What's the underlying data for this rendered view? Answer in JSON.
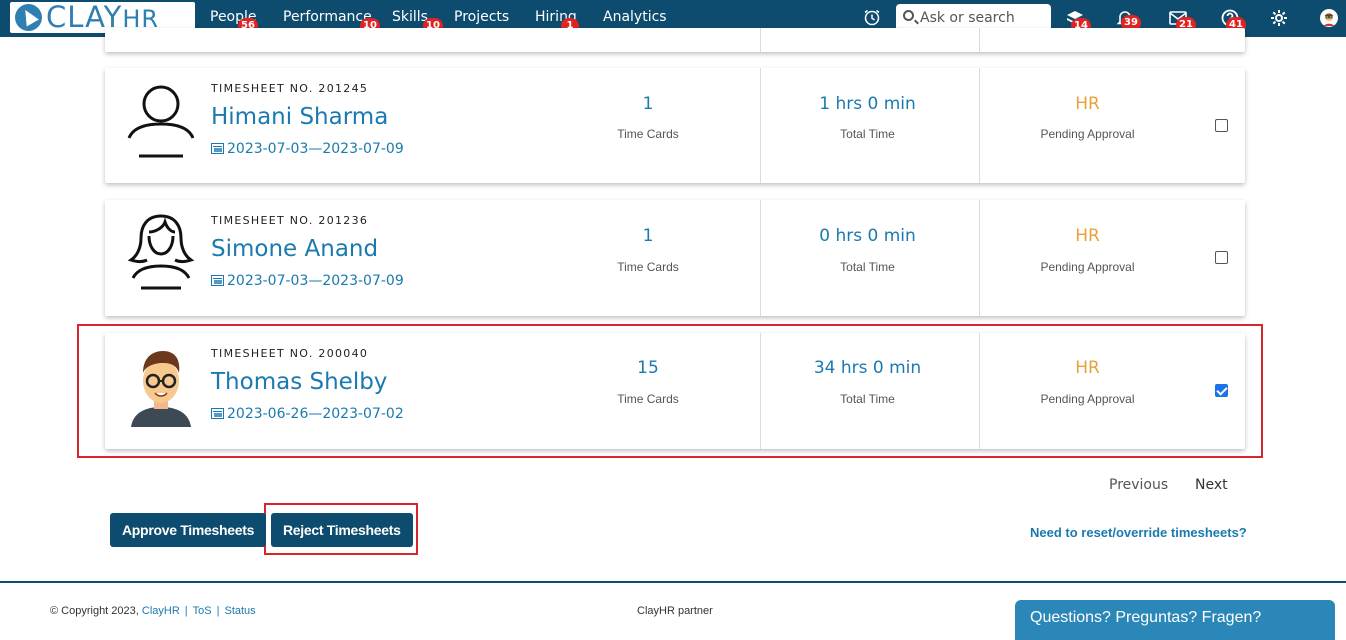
{
  "app": {
    "logo_text": "CLAY",
    "logo_suffix": "HR"
  },
  "nav": {
    "items": [
      {
        "label": "People",
        "badge": "56"
      },
      {
        "label": "Performance",
        "badge": "10"
      },
      {
        "label": "Skills",
        "badge": "10"
      },
      {
        "label": "Projects",
        "badge": ""
      },
      {
        "label": "Hiring",
        "badge": "1"
      },
      {
        "label": "Analytics",
        "badge": ""
      }
    ],
    "search_placeholder": "Ask or search",
    "icon_badges": {
      "learning": "14",
      "notifications": "39",
      "messages": "21",
      "help": "41"
    }
  },
  "timesheets": [
    {
      "number_label": "TIMESHEET NO. 201245",
      "name": "Himani Sharma",
      "range": "2023-07-03—2023-07-09",
      "time_cards": "1",
      "time_cards_label": "Time Cards",
      "total_time": "1 hrs 0 min",
      "total_time_label": "Total Time",
      "approver": "HR",
      "status": "Pending Approval",
      "selected": false
    },
    {
      "number_label": "TIMESHEET NO. 201236",
      "name": "Simone Anand",
      "range": "2023-07-03—2023-07-09",
      "time_cards": "1",
      "time_cards_label": "Time Cards",
      "total_time": "0 hrs 0 min",
      "total_time_label": "Total Time",
      "approver": "HR",
      "status": "Pending Approval",
      "selected": false
    },
    {
      "number_label": "TIMESHEET NO. 200040",
      "name": "Thomas Shelby",
      "range": "2023-06-26—2023-07-02",
      "time_cards": "15",
      "time_cards_label": "Time Cards",
      "total_time": "34 hrs 0 min",
      "total_time_label": "Total Time",
      "approver": "HR",
      "status": "Pending Approval",
      "selected": true
    }
  ],
  "pagination": {
    "previous": "Previous",
    "next": "Next"
  },
  "actions": {
    "approve": "Approve Timesheets",
    "reject": "Reject Timesheets",
    "reset_link": "Need to reset/override timesheets?"
  },
  "footer": {
    "copyright": "© Copyright 2023,",
    "clayhr_link": "ClayHR",
    "tos": "ToS",
    "status": "Status",
    "partner": "ClayHR partner",
    "chat": "Questions? Preguntas? Fragen?"
  },
  "colors": {
    "nav_bg": "#0d4c6e",
    "link": "#1a7ab0",
    "status": "#e8a23a",
    "highlight": "#d7262e",
    "badge": "#e02424"
  }
}
